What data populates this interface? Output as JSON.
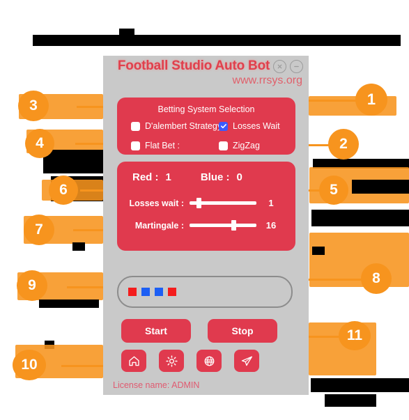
{
  "app": {
    "title": "Football Studio Auto Bot",
    "subtitle": "www.rrsys.org",
    "window_controls": [
      {
        "name": "close-button",
        "glyph": "close-circle-icon"
      },
      {
        "name": "minimize-button",
        "glyph": "minimize-circle-icon"
      }
    ]
  },
  "betting_panel": {
    "heading": "Betting System Selection",
    "options": [
      {
        "label": "D'alembert Strategy",
        "checked": false
      },
      {
        "label": "Losses Wait",
        "checked": true
      },
      {
        "label": "Flat Bet :",
        "checked": false
      },
      {
        "label": "ZigZag",
        "checked": false
      }
    ]
  },
  "stats_panel": {
    "red_label": "Red :",
    "red_value": "1",
    "blue_label": "Blue :",
    "blue_value": "0",
    "sliders": [
      {
        "label": "Losses wait :",
        "value": "1",
        "percent": 10
      },
      {
        "label": "Martingale :",
        "value": "16",
        "percent": 62
      }
    ]
  },
  "history": {
    "squares": [
      "red",
      "blue",
      "blue",
      "red"
    ],
    "colors": {
      "red": "#f41d1d",
      "blue": "#1d5ff4"
    }
  },
  "buttons": {
    "start": "Start",
    "stop": "Stop",
    "icons": [
      {
        "name": "home-icon",
        "label": "Home"
      },
      {
        "name": "settings-gear-icon",
        "label": "Settings"
      },
      {
        "name": "www-globe-icon",
        "label": "Website"
      },
      {
        "name": "telegram-send-icon",
        "label": "Telegram"
      }
    ]
  },
  "footer": {
    "license_label": "License name:",
    "license_value": "ADMIN"
  },
  "callouts": [
    {
      "number": "1",
      "side": "right"
    },
    {
      "number": "2",
      "side": "right"
    },
    {
      "number": "3",
      "side": "left"
    },
    {
      "number": "4",
      "side": "left"
    },
    {
      "number": "5",
      "side": "right"
    },
    {
      "number": "6",
      "side": "left"
    },
    {
      "number": "7",
      "side": "left"
    },
    {
      "number": "8",
      "side": "right"
    },
    {
      "number": "9",
      "side": "left"
    },
    {
      "number": "10",
      "side": "left"
    },
    {
      "number": "11",
      "side": "right"
    }
  ],
  "colors": {
    "accent_orange": "#f7941e",
    "panel_red": "#e03a4e",
    "window_gray": "#c9c9c9",
    "checkbox_blue": "#3b5bfd",
    "title_red": "#e0404d"
  }
}
